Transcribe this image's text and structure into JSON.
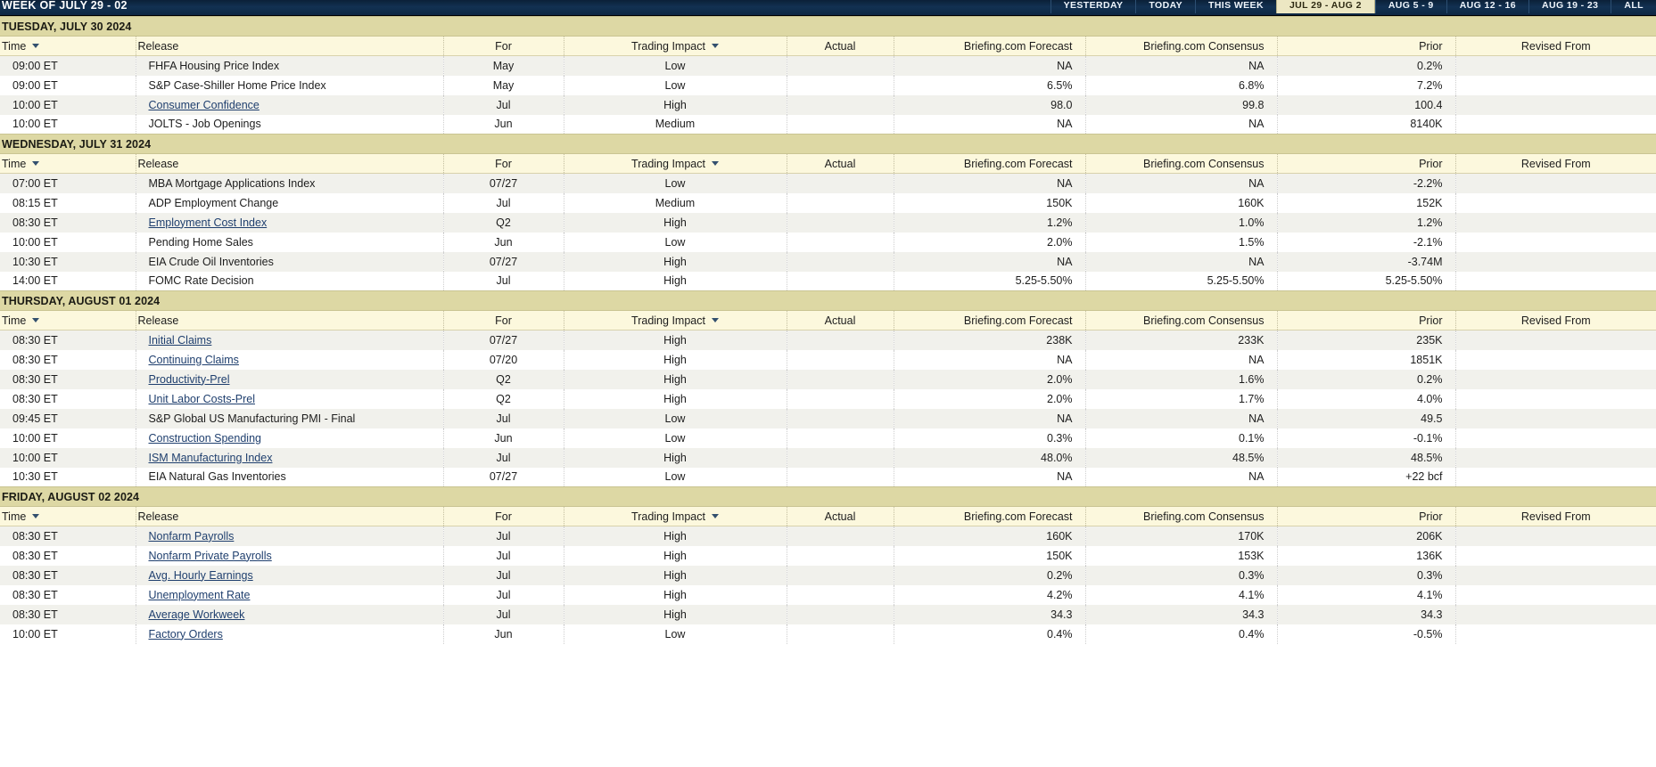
{
  "topbar": {
    "title": "WEEK OF JULY 29 - 02",
    "nav": [
      {
        "label": "YESTERDAY",
        "active": false
      },
      {
        "label": "TODAY",
        "active": false
      },
      {
        "label": "THIS WEEK",
        "active": false
      },
      {
        "label": "JUL 29 - AUG 2",
        "active": true
      },
      {
        "label": "AUG 5 - 9",
        "active": false
      },
      {
        "label": "AUG 12 - 16",
        "active": false
      },
      {
        "label": "AUG 19 - 23",
        "active": false
      },
      {
        "label": "ALL",
        "active": false
      }
    ],
    "colors": {
      "bar": "#123152",
      "active_tab": "#ece7c3"
    }
  },
  "columns": [
    {
      "key": "time",
      "label": "Time",
      "sortable": true
    },
    {
      "key": "release",
      "label": "Release",
      "sortable": false
    },
    {
      "key": "for",
      "label": "For",
      "sortable": false
    },
    {
      "key": "impact",
      "label": "Trading Impact",
      "sortable": true
    },
    {
      "key": "actual",
      "label": "Actual",
      "sortable": false
    },
    {
      "key": "forecast",
      "label": "Briefing.com Forecast",
      "sortable": false
    },
    {
      "key": "consensus",
      "label": "Briefing.com Consensus",
      "sortable": false
    },
    {
      "key": "prior",
      "label": "Prior",
      "sortable": false
    },
    {
      "key": "revised",
      "label": "Revised From",
      "sortable": false
    }
  ],
  "days": [
    {
      "header": "TUESDAY, JULY 30 2024",
      "rows": [
        {
          "time": "09:00 ET",
          "release": "FHFA Housing Price Index",
          "link": false,
          "for": "May",
          "impact": "Low",
          "actual": "",
          "forecast": "NA",
          "consensus": "NA",
          "prior": "0.2%",
          "revised": ""
        },
        {
          "time": "09:00 ET",
          "release": "S&P Case-Shiller Home Price Index",
          "link": false,
          "for": "May",
          "impact": "Low",
          "actual": "",
          "forecast": "6.5%",
          "consensus": "6.8%",
          "prior": "7.2%",
          "revised": ""
        },
        {
          "time": "10:00 ET",
          "release": "Consumer Confidence",
          "link": true,
          "for": "Jul",
          "impact": "High",
          "actual": "",
          "forecast": "98.0",
          "consensus": "99.8",
          "prior": "100.4",
          "revised": ""
        },
        {
          "time": "10:00 ET",
          "release": "JOLTS - Job Openings",
          "link": false,
          "for": "Jun",
          "impact": "Medium",
          "actual": "",
          "forecast": "NA",
          "consensus": "NA",
          "prior": "8140K",
          "revised": ""
        }
      ]
    },
    {
      "header": "WEDNESDAY, JULY 31 2024",
      "rows": [
        {
          "time": "07:00 ET",
          "release": "MBA Mortgage Applications Index",
          "link": false,
          "for": "07/27",
          "impact": "Low",
          "actual": "",
          "forecast": "NA",
          "consensus": "NA",
          "prior": "-2.2%",
          "revised": ""
        },
        {
          "time": "08:15 ET",
          "release": "ADP Employment Change",
          "link": false,
          "for": "Jul",
          "impact": "Medium",
          "actual": "",
          "forecast": "150K",
          "consensus": "160K",
          "prior": "152K",
          "revised": ""
        },
        {
          "time": "08:30 ET",
          "release": "Employment Cost Index",
          "link": true,
          "for": "Q2",
          "impact": "High",
          "actual": "",
          "forecast": "1.2%",
          "consensus": "1.0%",
          "prior": "1.2%",
          "revised": ""
        },
        {
          "time": "10:00 ET",
          "release": "Pending Home Sales",
          "link": false,
          "for": "Jun",
          "impact": "Low",
          "actual": "",
          "forecast": "2.0%",
          "consensus": "1.5%",
          "prior": "-2.1%",
          "revised": ""
        },
        {
          "time": "10:30 ET",
          "release": "EIA Crude Oil Inventories",
          "link": false,
          "for": "07/27",
          "impact": "High",
          "actual": "",
          "forecast": "NA",
          "consensus": "NA",
          "prior": "-3.74M",
          "revised": ""
        },
        {
          "time": "14:00 ET",
          "release": "FOMC Rate Decision",
          "link": false,
          "for": "Jul",
          "impact": "High",
          "actual": "",
          "forecast": "5.25-5.50%",
          "consensus": "5.25-5.50%",
          "prior": "5.25-5.50%",
          "revised": ""
        }
      ]
    },
    {
      "header": "THURSDAY, AUGUST 01 2024",
      "rows": [
        {
          "time": "08:30 ET",
          "release": "Initial Claims",
          "link": true,
          "for": "07/27",
          "impact": "High",
          "actual": "",
          "forecast": "238K",
          "consensus": "233K",
          "prior": "235K",
          "revised": ""
        },
        {
          "time": "08:30 ET",
          "release": "Continuing Claims",
          "link": true,
          "for": "07/20",
          "impact": "High",
          "actual": "",
          "forecast": "NA",
          "consensus": "NA",
          "prior": "1851K",
          "revised": ""
        },
        {
          "time": "08:30 ET",
          "release": "Productivity-Prel",
          "link": true,
          "for": "Q2",
          "impact": "High",
          "actual": "",
          "forecast": "2.0%",
          "consensus": "1.6%",
          "prior": "0.2%",
          "revised": ""
        },
        {
          "time": "08:30 ET",
          "release": "Unit Labor Costs-Prel",
          "link": true,
          "for": "Q2",
          "impact": "High",
          "actual": "",
          "forecast": "2.0%",
          "consensus": "1.7%",
          "prior": "4.0%",
          "revised": ""
        },
        {
          "time": "09:45 ET",
          "release": "S&P Global US Manufacturing PMI - Final",
          "link": false,
          "for": "Jul",
          "impact": "Low",
          "actual": "",
          "forecast": "NA",
          "consensus": "NA",
          "prior": "49.5",
          "revised": ""
        },
        {
          "time": "10:00 ET",
          "release": "Construction Spending",
          "link": true,
          "for": "Jun",
          "impact": "Low",
          "actual": "",
          "forecast": "0.3%",
          "consensus": "0.1%",
          "prior": "-0.1%",
          "revised": ""
        },
        {
          "time": "10:00 ET",
          "release": "ISM Manufacturing Index",
          "link": true,
          "for": "Jul",
          "impact": "High",
          "actual": "",
          "forecast": "48.0%",
          "consensus": "48.5%",
          "prior": "48.5%",
          "revised": ""
        },
        {
          "time": "10:30 ET",
          "release": "EIA Natural Gas Inventories",
          "link": false,
          "for": "07/27",
          "impact": "Low",
          "actual": "",
          "forecast": "NA",
          "consensus": "NA",
          "prior": "+22 bcf",
          "revised": ""
        }
      ]
    },
    {
      "header": "FRIDAY, AUGUST 02 2024",
      "rows": [
        {
          "time": "08:30 ET",
          "release": "Nonfarm Payrolls",
          "link": true,
          "for": "Jul",
          "impact": "High",
          "actual": "",
          "forecast": "160K",
          "consensus": "170K",
          "prior": "206K",
          "revised": ""
        },
        {
          "time": "08:30 ET",
          "release": "Nonfarm Private Payrolls",
          "link": true,
          "for": "Jul",
          "impact": "High",
          "actual": "",
          "forecast": "150K",
          "consensus": "153K",
          "prior": "136K",
          "revised": ""
        },
        {
          "time": "08:30 ET",
          "release": "Avg. Hourly Earnings",
          "link": true,
          "for": "Jul",
          "impact": "High",
          "actual": "",
          "forecast": "0.2%",
          "consensus": "0.3%",
          "prior": "0.3%",
          "revised": ""
        },
        {
          "time": "08:30 ET",
          "release": "Unemployment Rate",
          "link": true,
          "for": "Jul",
          "impact": "High",
          "actual": "",
          "forecast": "4.2%",
          "consensus": "4.1%",
          "prior": "4.1%",
          "revised": ""
        },
        {
          "time": "08:30 ET",
          "release": "Average Workweek",
          "link": true,
          "for": "Jul",
          "impact": "High",
          "actual": "",
          "forecast": "34.3",
          "consensus": "34.3",
          "prior": "34.3",
          "revised": ""
        },
        {
          "time": "10:00 ET",
          "release": "Factory Orders",
          "link": true,
          "for": "Jun",
          "impact": "Low",
          "actual": "",
          "forecast": "0.4%",
          "consensus": "0.4%",
          "prior": "-0.5%",
          "revised": ""
        }
      ]
    }
  ]
}
